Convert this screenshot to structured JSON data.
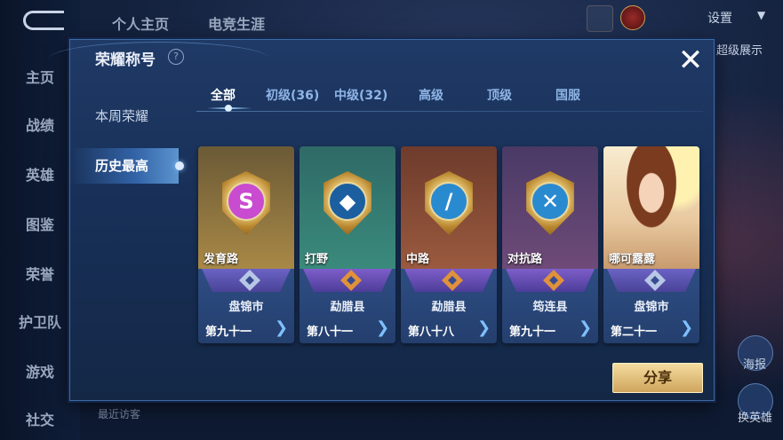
{
  "background": {
    "top_tabs": [
      "个人主页",
      "电竞生涯"
    ],
    "settings_label": "设置",
    "right_label": "超级展示",
    "left_nav": [
      "主页",
      "战绩",
      "英雄",
      "图鉴",
      "荣誉",
      "护卫队",
      "游戏",
      "社交"
    ],
    "right_rail": [
      "海报",
      "换英雄"
    ],
    "bottom_text": "最近访客"
  },
  "modal": {
    "title": "荣耀称号",
    "close_glyph": "✕",
    "help_glyph": "?",
    "side_menu": [
      {
        "label": "本周荣耀",
        "active": false
      },
      {
        "label": "历史最高",
        "active": true
      }
    ],
    "tabs": [
      {
        "label": "全部",
        "active": true
      },
      {
        "label": "初级(36)",
        "active": false
      },
      {
        "label": "中级(32)",
        "active": false
      },
      {
        "label": "高级",
        "active": false
      },
      {
        "label": "顶级",
        "active": false
      },
      {
        "label": "国服",
        "active": false
      }
    ],
    "cards": [
      {
        "label": "发育路",
        "region": "盘锦市",
        "rank": "第九十一",
        "glyph": "S",
        "theme": "#b38a3a"
      },
      {
        "label": "打野",
        "region": "勐腊县",
        "rank": "第八十一",
        "glyph": "◆",
        "theme": "#2d7a6e"
      },
      {
        "label": "中路",
        "region": "勐腊县",
        "rank": "第八十八",
        "glyph": "/",
        "theme": "#8a4a34"
      },
      {
        "label": "对抗路",
        "region": "筠连县",
        "rank": "第九十一",
        "glyph": "✕",
        "theme": "#5a4a74"
      },
      {
        "label": "哪可露露",
        "region": "盘锦市",
        "rank": "第二十一",
        "glyph": "",
        "theme": "#e6c7a2"
      }
    ],
    "share_label": "分享"
  },
  "colors": {
    "accent": "#7ec0ff",
    "share_button": "#e6c57e",
    "modal_bg": "#1f3a66"
  }
}
